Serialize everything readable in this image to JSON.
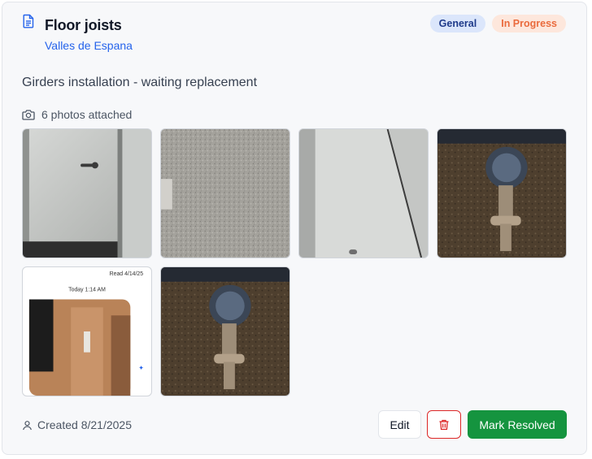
{
  "issue": {
    "title": "Floor joists",
    "location": "Valles de Espana",
    "description": "Girders installation - waiting replacement",
    "badges": {
      "category": "General",
      "status": "In Progress"
    },
    "photos_label": "6 photos attached",
    "photos": [
      {
        "name": "white-door-handle"
      },
      {
        "name": "textured-wall"
      },
      {
        "name": "door-frame"
      },
      {
        "name": "water-meter-pit"
      },
      {
        "name": "phone-screenshot-house",
        "overlay_lines": [
          "Read 4/14/25",
          "Today 1:14 AM"
        ]
      },
      {
        "name": "water-meter-pit"
      }
    ],
    "created": "Created 8/21/2025"
  },
  "actions": {
    "edit_label": "Edit",
    "delete_icon": "trash-icon",
    "resolve_label": "Mark Resolved"
  },
  "colors": {
    "accent_link": "#2563eb",
    "badge_general_bg": "#dbe6fb",
    "badge_status_bg": "#fde7dc",
    "badge_status_text": "#ea6b3d",
    "danger": "#dc2626",
    "success": "#15943f"
  }
}
